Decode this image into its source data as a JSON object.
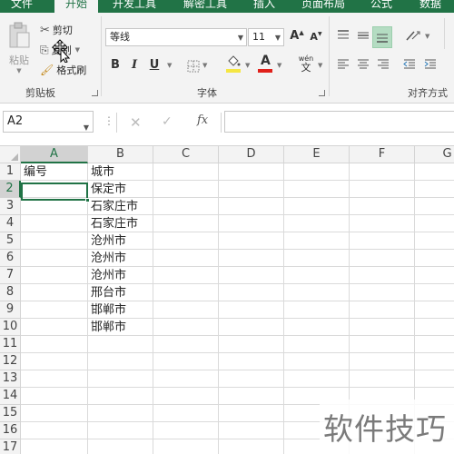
{
  "ribbon_tabs": [
    {
      "label": "文件",
      "active": false
    },
    {
      "label": "开始",
      "active": true
    },
    {
      "label": "开发工具",
      "active": false
    },
    {
      "label": "解密工具",
      "active": false
    },
    {
      "label": "插入",
      "active": false
    },
    {
      "label": "页面布局",
      "active": false
    },
    {
      "label": "公式",
      "active": false
    },
    {
      "label": "数据",
      "active": false
    }
  ],
  "clipboard": {
    "paste_label": "粘贴",
    "cut_label": "剪切",
    "copy_label": "复制",
    "format_painter_label": "格式刷",
    "group_label": "剪贴板"
  },
  "font": {
    "font_name": "等线",
    "font_size": "11",
    "bold": "B",
    "italic": "I",
    "underline": "U",
    "increase_size": "A",
    "decrease_size": "A",
    "pinyin": "wén",
    "pinyin_char": "文",
    "font_color_letter": "A",
    "group_label": "字体",
    "fill_color": "#f5e642",
    "font_color": "#e0201a"
  },
  "alignment": {
    "group_label": "对齐方式"
  },
  "formula_bar": {
    "name_box": "A2",
    "fx": "fx",
    "formula": ""
  },
  "sheet": {
    "columns": [
      "A",
      "B",
      "C",
      "D",
      "E",
      "F",
      "G"
    ],
    "selected_column": "A",
    "rows": [
      "1",
      "2",
      "3",
      "4",
      "5",
      "6",
      "7",
      "8",
      "9",
      "10",
      "11",
      "12",
      "13",
      "14",
      "15",
      "16",
      "17"
    ],
    "selected_row": "2",
    "active_cell": "A2",
    "cells": [
      {
        "ref": "A1",
        "value": "编号"
      },
      {
        "ref": "B1",
        "value": "城市"
      },
      {
        "ref": "B2",
        "value": "保定市"
      },
      {
        "ref": "B3",
        "value": "石家庄市"
      },
      {
        "ref": "B4",
        "value": "石家庄市"
      },
      {
        "ref": "B5",
        "value": "沧州市"
      },
      {
        "ref": "B6",
        "value": "沧州市"
      },
      {
        "ref": "B7",
        "value": "沧州市"
      },
      {
        "ref": "B8",
        "value": "邢台市"
      },
      {
        "ref": "B9",
        "value": "邯郸市"
      },
      {
        "ref": "B10",
        "value": "邯郸市"
      }
    ]
  },
  "watermark": "软件技巧",
  "colors": {
    "accent": "#217346",
    "ribbon_bg": "#f3f3f3"
  }
}
